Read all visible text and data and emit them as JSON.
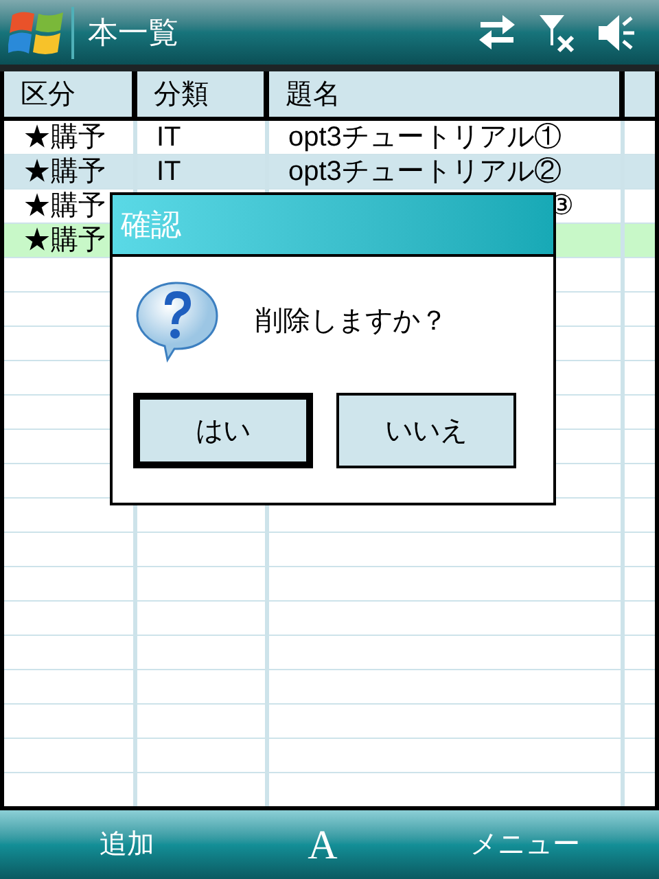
{
  "window": {
    "title": "本一覧"
  },
  "table": {
    "columns": [
      "区分",
      "分類",
      "題名"
    ],
    "rows": [
      {
        "category": "★購予",
        "class": "IT",
        "title": "opt3チュートリアル①",
        "selected": false
      },
      {
        "category": "★購予",
        "class": "IT",
        "title": "opt3チュートリアル②",
        "selected": false
      },
      {
        "category": "★購予",
        "class": "",
        "title": "③",
        "selected": false
      },
      {
        "category": "★購予",
        "class": "",
        "title": "",
        "selected": true
      }
    ]
  },
  "dialog": {
    "title": "確認",
    "message": "削除しますか？",
    "buttons": [
      {
        "label": "はい",
        "default": true
      },
      {
        "label": "いいえ",
        "default": false
      }
    ]
  },
  "softkeys": {
    "left": "追加",
    "center": "A",
    "right": "メニュー"
  }
}
